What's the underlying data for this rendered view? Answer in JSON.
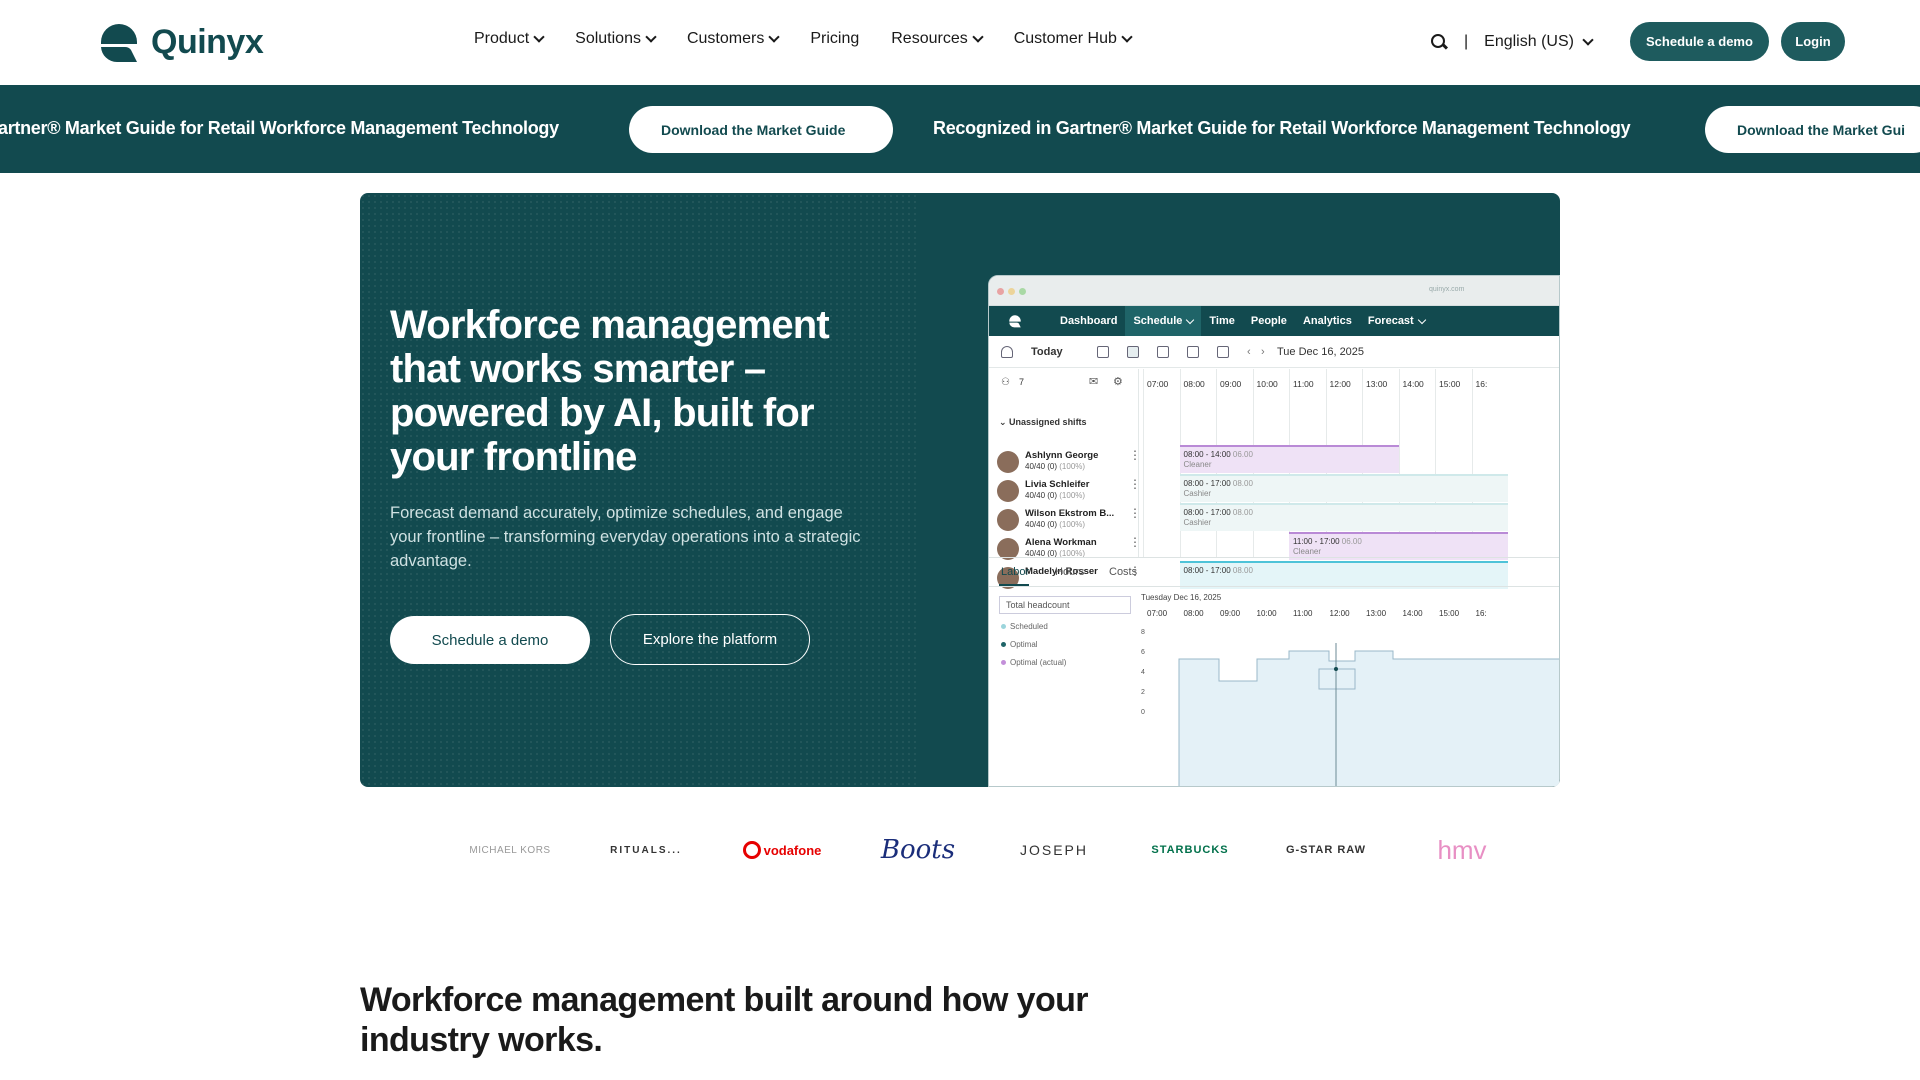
{
  "brand": {
    "name": "Quinyx"
  },
  "nav": {
    "links": [
      {
        "label": "Product",
        "dropdown": true
      },
      {
        "label": "Solutions",
        "dropdown": true
      },
      {
        "label": "Customers",
        "dropdown": true
      },
      {
        "label": "Pricing",
        "dropdown": false
      },
      {
        "label": "Resources",
        "dropdown": true
      },
      {
        "label": "Customer Hub",
        "dropdown": true
      }
    ],
    "separator": "|",
    "language": "English (US)",
    "demo_button": "Schedule a demo",
    "login_button": "Login"
  },
  "banner": {
    "text_left": "artner® Market Guide for Retail Workforce Management Technology",
    "button_1": "Download the Market Guide",
    "text_right": "Recognized in Gartner® Market Guide for Retail Workforce Management Technology",
    "button_2": "Download the Market Gui"
  },
  "hero": {
    "title": "Workforce management that works smarter – powered by AI, built for your frontline",
    "subtitle": "Forecast demand accurately, optimize schedules, and engage your frontline – transforming everyday operations into a strategic advantage.",
    "cta_primary": "Schedule a demo",
    "cta_secondary": "Explore the platform"
  },
  "app": {
    "url": "quinyx.com",
    "tabs": [
      {
        "label": "Dashboard",
        "dropdown": false,
        "active": false
      },
      {
        "label": "Schedule",
        "dropdown": true,
        "active": true
      },
      {
        "label": "Time",
        "dropdown": false,
        "active": false
      },
      {
        "label": "People",
        "dropdown": false,
        "active": false
      },
      {
        "label": "Analytics",
        "dropdown": false,
        "active": false
      },
      {
        "label": "Forecast",
        "dropdown": true,
        "active": false
      }
    ],
    "today_label": "Today",
    "date_label": "Tue Dec 16, 2025",
    "people_count": "7",
    "unassigned_label": "Unassigned shifts",
    "hours": [
      "07:00",
      "08:00",
      "09:00",
      "10:00",
      "11:00",
      "12:00",
      "13:00",
      "14:00",
      "15:00",
      "16:"
    ],
    "employees": [
      {
        "name": "Ashlynn George",
        "hours": "40/40 (0)",
        "pct": "(100%)"
      },
      {
        "name": "Livia Schleifer",
        "hours": "40/40 (0)",
        "pct": "(100%)"
      },
      {
        "name": "Wilson Ekstrom B...",
        "hours": "40/40 (0)",
        "pct": "(100%)"
      },
      {
        "name": "Alena Workman",
        "hours": "40/40 (0)",
        "pct": "(100%)"
      },
      {
        "name": "Madelyn Rosser",
        "hours": "",
        "pct": ""
      }
    ],
    "shifts": [
      {
        "time": "08:00 - 14:00",
        "extra": "06.00",
        "role": "Cleaner",
        "color": "#b98ad6"
      },
      {
        "time": "08:00 - 17:00",
        "extra": "08.00",
        "role": "Cashier",
        "color": "#cfe9ea"
      },
      {
        "time": "08:00 - 17:00",
        "extra": "08.00",
        "role": "Cashier",
        "color": "#cfe9ea"
      },
      {
        "time": "11:00 - 17:00",
        "extra": "06.00",
        "role": "Cleaner",
        "color": "#b98ad6"
      },
      {
        "time": "08:00 - 17:00",
        "extra": "08.00",
        "role": "",
        "color": "#4ec3d8"
      }
    ],
    "bottom_tabs": [
      "Labor",
      "Hours",
      "Costs"
    ],
    "select_label": "Total headcount",
    "legend": [
      {
        "label": "Scheduled",
        "color": "#9cd5dc"
      },
      {
        "label": "Optimal",
        "color": "#1f6468"
      },
      {
        "label": "Optimal (actual)",
        "color": "#c38fd9"
      }
    ],
    "chart_date": "Tuesday Dec 16, 2025",
    "y_ticks": [
      "8",
      "6",
      "4",
      "2",
      "0"
    ]
  },
  "logos": [
    "MICHAEL KORS",
    "RITUALS...",
    "vodafone",
    "Boots",
    "JOSEPH",
    "STARBUCKS",
    "G-STAR RAW",
    "hmv"
  ],
  "section": {
    "title": "Workforce management built around how your industry works."
  },
  "colors": {
    "brand_dark": "#124a4f",
    "brand_button": "#1e5b5e"
  }
}
